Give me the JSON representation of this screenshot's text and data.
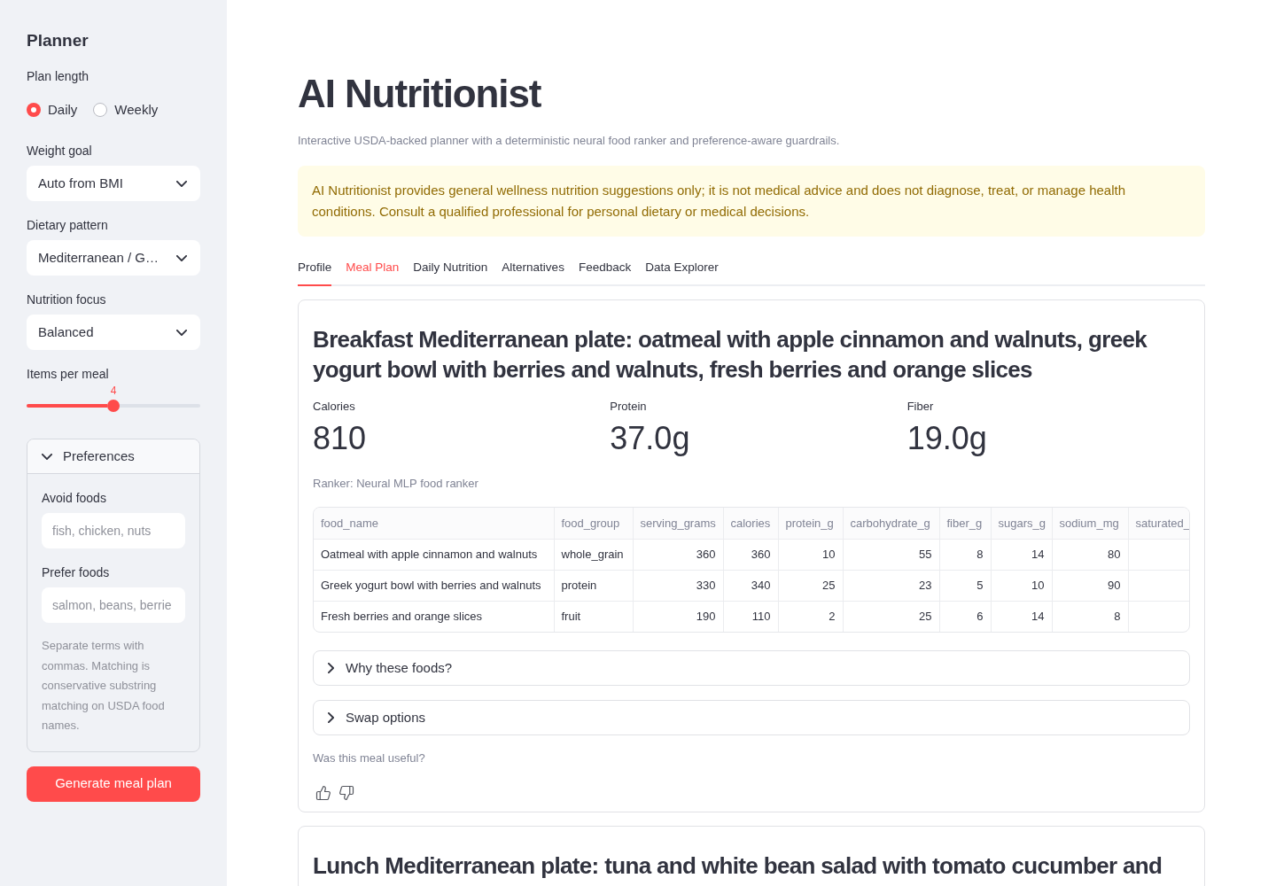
{
  "sidebar": {
    "title": "Planner",
    "plan_length": {
      "label": "Plan length",
      "options": [
        {
          "label": "Daily",
          "selected": true
        },
        {
          "label": "Weekly",
          "selected": false
        }
      ]
    },
    "selects": [
      {
        "label": "Weight goal",
        "value": "Auto from BMI"
      },
      {
        "label": "Dietary pattern",
        "value": "Mediterranean / G…"
      },
      {
        "label": "Nutrition focus",
        "value": "Balanced"
      }
    ],
    "slider": {
      "label": "Items per meal",
      "reading": "4",
      "level": 0.5
    },
    "preferences": {
      "title": "Preferences",
      "expanded": true,
      "fields": [
        {
          "label": "Avoid foods",
          "placeholder": "fish, chicken, nuts"
        },
        {
          "label": "Prefer foods",
          "placeholder": "salmon, beans, berrie"
        }
      ],
      "help": "Separate terms with commas. Matching is conservative substring matching on USDA food names."
    },
    "button": "Generate meal plan"
  },
  "header": {
    "title": "AI Nutritionist",
    "subtitle": "Interactive USDA-backed planner with a deterministic neural food ranker and preference-aware guardrails."
  },
  "notice": "AI Nutritionist provides general wellness nutrition suggestions only; it is not medical advice and does not diagnose, treat, or manage health conditions. Consult a qualified professional for personal dietary or medical decisions.",
  "tabs": [
    {
      "label": "Profile",
      "selected": false,
      "underlined": true
    },
    {
      "label": "Meal Plan",
      "selected": true,
      "underlined": false
    },
    {
      "label": "Daily Nutrition",
      "selected": false,
      "underlined": false
    },
    {
      "label": "Alternatives",
      "selected": false,
      "underlined": false
    },
    {
      "label": "Feedback",
      "selected": false,
      "underlined": false
    },
    {
      "label": "Data Explorer",
      "selected": false,
      "underlined": false
    }
  ],
  "meals": [
    {
      "title": "Breakfast Mediterranean plate: oatmeal with apple cinnamon and walnuts, greek yogurt bowl with berries and walnuts, fresh berries and orange slices",
      "metrics": [
        {
          "label": "Calories",
          "value": "810"
        },
        {
          "label": "Protein",
          "value": "37.0g"
        },
        {
          "label": "Fiber",
          "value": "19.0g"
        }
      ],
      "ranker": "Ranker: Neural MLP food ranker",
      "table": {
        "columns": [
          {
            "label": "food_name",
            "kind": "text"
          },
          {
            "label": "food_group",
            "kind": "text"
          },
          {
            "label": "serving_grams",
            "kind": "number"
          },
          {
            "label": "calories",
            "kind": "number"
          },
          {
            "label": "protein_g",
            "kind": "number"
          },
          {
            "label": "carbohydrate_g",
            "kind": "number"
          },
          {
            "label": "fiber_g",
            "kind": "number"
          },
          {
            "label": "sugars_g",
            "kind": "number"
          },
          {
            "label": "sodium_mg",
            "kind": "number"
          },
          {
            "label": "saturated_",
            "kind": "number"
          }
        ],
        "rows": [
          [
            "Oatmeal with apple cinnamon and walnuts",
            "whole_grain",
            "360",
            "360",
            "10",
            "55",
            "8",
            "14",
            "80"
          ],
          [
            "Greek yogurt bowl with berries and walnuts",
            "protein",
            "330",
            "340",
            "25",
            "23",
            "5",
            "10",
            "90"
          ],
          [
            "Fresh berries and orange slices",
            "fruit",
            "190",
            "110",
            "2",
            "25",
            "6",
            "14",
            "8"
          ]
        ]
      },
      "expanders": [
        {
          "label": "Why these foods?",
          "expanded": false
        },
        {
          "label": "Swap options",
          "expanded": false
        }
      ],
      "feedback": {
        "prompt": "Was this meal useful?"
      }
    },
    {
      "title": "Lunch Mediterranean plate: tuna and white bean salad with tomato cucumber and"
    }
  ]
}
